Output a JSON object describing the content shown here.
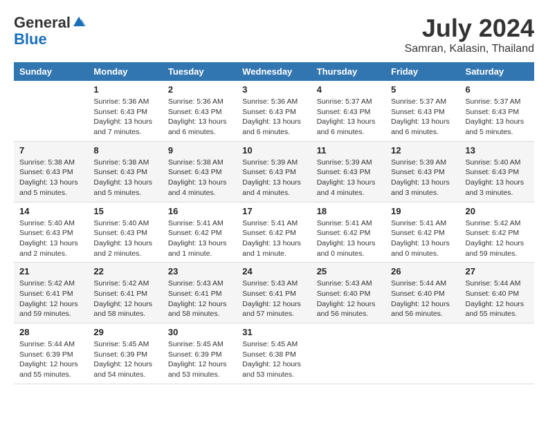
{
  "header": {
    "logo_general": "General",
    "logo_blue": "Blue",
    "month_year": "July 2024",
    "location": "Samran, Kalasin, Thailand"
  },
  "weekdays": [
    "Sunday",
    "Monday",
    "Tuesday",
    "Wednesday",
    "Thursday",
    "Friday",
    "Saturday"
  ],
  "weeks": [
    [
      {
        "day": "",
        "sunrise": "",
        "sunset": "",
        "daylight": ""
      },
      {
        "day": "1",
        "sunrise": "Sunrise: 5:36 AM",
        "sunset": "Sunset: 6:43 PM",
        "daylight": "Daylight: 13 hours and 7 minutes."
      },
      {
        "day": "2",
        "sunrise": "Sunrise: 5:36 AM",
        "sunset": "Sunset: 6:43 PM",
        "daylight": "Daylight: 13 hours and 6 minutes."
      },
      {
        "day": "3",
        "sunrise": "Sunrise: 5:36 AM",
        "sunset": "Sunset: 6:43 PM",
        "daylight": "Daylight: 13 hours and 6 minutes."
      },
      {
        "day": "4",
        "sunrise": "Sunrise: 5:37 AM",
        "sunset": "Sunset: 6:43 PM",
        "daylight": "Daylight: 13 hours and 6 minutes."
      },
      {
        "day": "5",
        "sunrise": "Sunrise: 5:37 AM",
        "sunset": "Sunset: 6:43 PM",
        "daylight": "Daylight: 13 hours and 6 minutes."
      },
      {
        "day": "6",
        "sunrise": "Sunrise: 5:37 AM",
        "sunset": "Sunset: 6:43 PM",
        "daylight": "Daylight: 13 hours and 5 minutes."
      }
    ],
    [
      {
        "day": "7",
        "sunrise": "Sunrise: 5:38 AM",
        "sunset": "Sunset: 6:43 PM",
        "daylight": "Daylight: 13 hours and 5 minutes."
      },
      {
        "day": "8",
        "sunrise": "Sunrise: 5:38 AM",
        "sunset": "Sunset: 6:43 PM",
        "daylight": "Daylight: 13 hours and 5 minutes."
      },
      {
        "day": "9",
        "sunrise": "Sunrise: 5:38 AM",
        "sunset": "Sunset: 6:43 PM",
        "daylight": "Daylight: 13 hours and 4 minutes."
      },
      {
        "day": "10",
        "sunrise": "Sunrise: 5:39 AM",
        "sunset": "Sunset: 6:43 PM",
        "daylight": "Daylight: 13 hours and 4 minutes."
      },
      {
        "day": "11",
        "sunrise": "Sunrise: 5:39 AM",
        "sunset": "Sunset: 6:43 PM",
        "daylight": "Daylight: 13 hours and 4 minutes."
      },
      {
        "day": "12",
        "sunrise": "Sunrise: 5:39 AM",
        "sunset": "Sunset: 6:43 PM",
        "daylight": "Daylight: 13 hours and 3 minutes."
      },
      {
        "day": "13",
        "sunrise": "Sunrise: 5:40 AM",
        "sunset": "Sunset: 6:43 PM",
        "daylight": "Daylight: 13 hours and 3 minutes."
      }
    ],
    [
      {
        "day": "14",
        "sunrise": "Sunrise: 5:40 AM",
        "sunset": "Sunset: 6:43 PM",
        "daylight": "Daylight: 13 hours and 2 minutes."
      },
      {
        "day": "15",
        "sunrise": "Sunrise: 5:40 AM",
        "sunset": "Sunset: 6:43 PM",
        "daylight": "Daylight: 13 hours and 2 minutes."
      },
      {
        "day": "16",
        "sunrise": "Sunrise: 5:41 AM",
        "sunset": "Sunset: 6:42 PM",
        "daylight": "Daylight: 13 hours and 1 minute."
      },
      {
        "day": "17",
        "sunrise": "Sunrise: 5:41 AM",
        "sunset": "Sunset: 6:42 PM",
        "daylight": "Daylight: 13 hours and 1 minute."
      },
      {
        "day": "18",
        "sunrise": "Sunrise: 5:41 AM",
        "sunset": "Sunset: 6:42 PM",
        "daylight": "Daylight: 13 hours and 0 minutes."
      },
      {
        "day": "19",
        "sunrise": "Sunrise: 5:41 AM",
        "sunset": "Sunset: 6:42 PM",
        "daylight": "Daylight: 13 hours and 0 minutes."
      },
      {
        "day": "20",
        "sunrise": "Sunrise: 5:42 AM",
        "sunset": "Sunset: 6:42 PM",
        "daylight": "Daylight: 12 hours and 59 minutes."
      }
    ],
    [
      {
        "day": "21",
        "sunrise": "Sunrise: 5:42 AM",
        "sunset": "Sunset: 6:41 PM",
        "daylight": "Daylight: 12 hours and 59 minutes."
      },
      {
        "day": "22",
        "sunrise": "Sunrise: 5:42 AM",
        "sunset": "Sunset: 6:41 PM",
        "daylight": "Daylight: 12 hours and 58 minutes."
      },
      {
        "day": "23",
        "sunrise": "Sunrise: 5:43 AM",
        "sunset": "Sunset: 6:41 PM",
        "daylight": "Daylight: 12 hours and 58 minutes."
      },
      {
        "day": "24",
        "sunrise": "Sunrise: 5:43 AM",
        "sunset": "Sunset: 6:41 PM",
        "daylight": "Daylight: 12 hours and 57 minutes."
      },
      {
        "day": "25",
        "sunrise": "Sunrise: 5:43 AM",
        "sunset": "Sunset: 6:40 PM",
        "daylight": "Daylight: 12 hours and 56 minutes."
      },
      {
        "day": "26",
        "sunrise": "Sunrise: 5:44 AM",
        "sunset": "Sunset: 6:40 PM",
        "daylight": "Daylight: 12 hours and 56 minutes."
      },
      {
        "day": "27",
        "sunrise": "Sunrise: 5:44 AM",
        "sunset": "Sunset: 6:40 PM",
        "daylight": "Daylight: 12 hours and 55 minutes."
      }
    ],
    [
      {
        "day": "28",
        "sunrise": "Sunrise: 5:44 AM",
        "sunset": "Sunset: 6:39 PM",
        "daylight": "Daylight: 12 hours and 55 minutes."
      },
      {
        "day": "29",
        "sunrise": "Sunrise: 5:45 AM",
        "sunset": "Sunset: 6:39 PM",
        "daylight": "Daylight: 12 hours and 54 minutes."
      },
      {
        "day": "30",
        "sunrise": "Sunrise: 5:45 AM",
        "sunset": "Sunset: 6:39 PM",
        "daylight": "Daylight: 12 hours and 53 minutes."
      },
      {
        "day": "31",
        "sunrise": "Sunrise: 5:45 AM",
        "sunset": "Sunset: 6:38 PM",
        "daylight": "Daylight: 12 hours and 53 minutes."
      },
      {
        "day": "",
        "sunrise": "",
        "sunset": "",
        "daylight": ""
      },
      {
        "day": "",
        "sunrise": "",
        "sunset": "",
        "daylight": ""
      },
      {
        "day": "",
        "sunrise": "",
        "sunset": "",
        "daylight": ""
      }
    ]
  ]
}
